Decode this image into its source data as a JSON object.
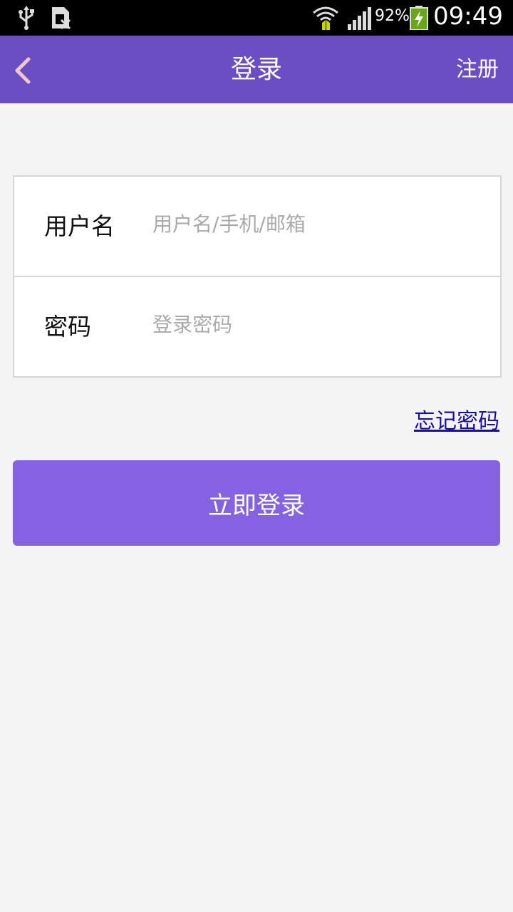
{
  "status_bar": {
    "battery_percent": "92%",
    "time": "09:49",
    "icons": [
      "usb-icon",
      "sim-card-icon",
      "wifi-icon",
      "signal-icon",
      "battery-charging-icon"
    ]
  },
  "app_bar": {
    "title": "登录",
    "register_label": "注册",
    "back_icon": "chevron-left-icon"
  },
  "form": {
    "username": {
      "label": "用户名",
      "placeholder": "用户名/手机/邮箱",
      "value": ""
    },
    "password": {
      "label": "密码",
      "placeholder": "登录密码",
      "value": ""
    }
  },
  "forgot_password_label": "忘记密码",
  "login_button_label": "立即登录",
  "colors": {
    "app_bar": "#6b4dc4",
    "button": "#8563e0",
    "background": "#f4f4f4",
    "link": "#1a0dab"
  }
}
